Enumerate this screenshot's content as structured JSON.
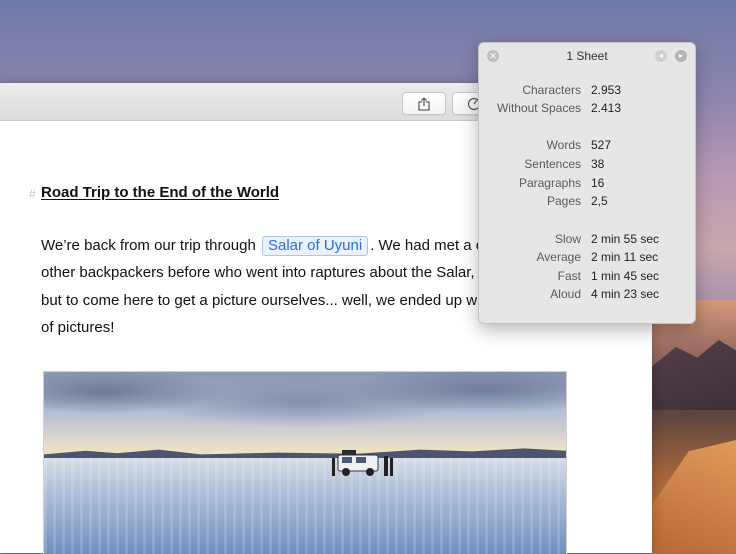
{
  "editor": {
    "heading_mark": "#",
    "heading": "Road Trip to the End of the World",
    "paragraph": {
      "line1_before": "We’re back from our trip through",
      "tag": "Salar of Uyuni",
      "line1_after": ". We had met a c",
      "line2": "other backpackers before who went into raptures about the Salar,",
      "line3": "but to come here to get a picture ourselves... well, we ended up wi",
      "line4": "of pictures!"
    }
  },
  "toolbar": {
    "share_icon": "share-icon",
    "stats_icon": "stats-gauge-icon"
  },
  "popover": {
    "title": "1 Sheet",
    "stats": [
      {
        "label": "Characters",
        "value": "2.953"
      },
      {
        "label": "Without Spaces",
        "value": "2.413"
      },
      {
        "label": "Words",
        "value": "527"
      },
      {
        "label": "Sentences",
        "value": "38"
      },
      {
        "label": "Paragraphs",
        "value": "16"
      },
      {
        "label": "Pages",
        "value": "2,5"
      },
      {
        "label": "Slow",
        "value": "2 min 55 sec"
      },
      {
        "label": "Average",
        "value": "2 min 11 sec"
      },
      {
        "label": "Fast",
        "value": "1 min 45 sec"
      },
      {
        "label": "Aloud",
        "value": "4 min 23 sec"
      }
    ]
  }
}
